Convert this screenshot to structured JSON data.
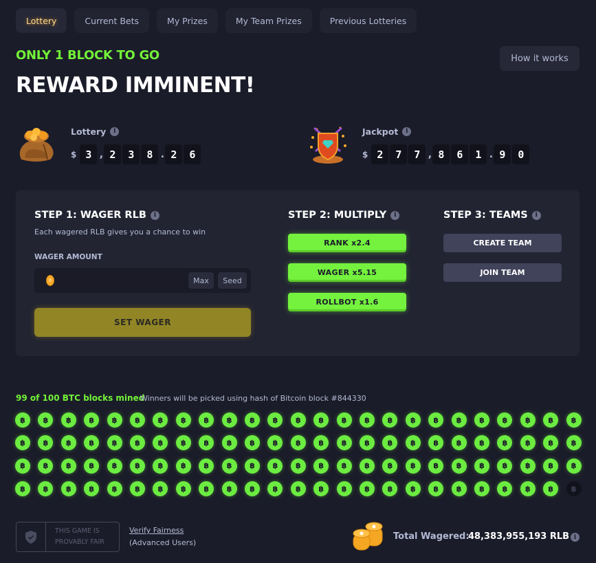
{
  "tabs": [
    {
      "label": "Lottery",
      "active": true
    },
    {
      "label": "Current Bets",
      "active": false
    },
    {
      "label": "My Prizes",
      "active": false
    },
    {
      "label": "My Team Prizes",
      "active": false
    },
    {
      "label": "Previous Lotteries",
      "active": false
    }
  ],
  "header": {
    "subtitle": "ONLY 1 BLOCK TO GO",
    "title": "REWARD IMMINENT!",
    "how_it_works": "How it works"
  },
  "lottery": {
    "label": "Lottery",
    "currency": "$",
    "amount": "3,238.26"
  },
  "jackpot": {
    "label": "Jackpot",
    "currency": "$",
    "amount": "277,861.90"
  },
  "step1": {
    "title": "STEP 1: WAGER RLB",
    "description": "Each wagered RLB gives you a chance to win",
    "wager_label": "WAGER AMOUNT",
    "wager_value": "",
    "coin_glyph": "0",
    "max_label": "Max",
    "seed_label": "Seed",
    "set_wager_label": "SET WAGER"
  },
  "step2": {
    "title": "STEP 2: MULTIPLY",
    "multipliers": [
      {
        "label": "RANK x2.4"
      },
      {
        "label": "WAGER x5.15"
      },
      {
        "label": "ROLLBOT x1.6"
      }
    ]
  },
  "step3": {
    "title": "STEP 3: TEAMS",
    "create_label": "CREATE TEAM",
    "join_label": "JOIN TEAM"
  },
  "blocks": {
    "mined_text": "99 of 100 BTC blocks mined",
    "winners_text": "Winners will be picked using hash of Bitcoin block #844330",
    "mined": 99,
    "total": 100,
    "glyph": "฿"
  },
  "footer": {
    "fair_line1": "THIS GAME IS",
    "fair_line2": "PROVABLY FAIR",
    "verify_label": "Verify Fairness",
    "advanced_label": "(Advanced Users)",
    "total_label": "Total Wagered:",
    "total_value": "48,383,955,193 RLB"
  },
  "colors": {
    "accent_green": "#72f238",
    "gold_button": "#918526",
    "background": "#1b1c29"
  }
}
